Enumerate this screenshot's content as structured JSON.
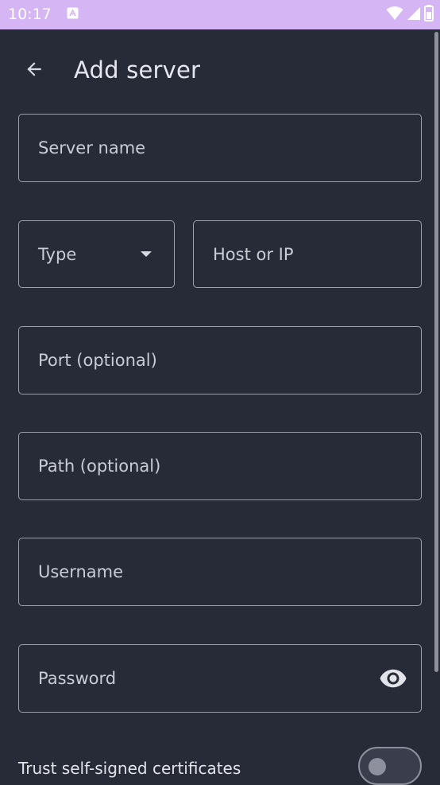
{
  "status_bar": {
    "time": "10:17"
  },
  "header": {
    "title": "Add server"
  },
  "form": {
    "server_name": {
      "placeholder": "Server name"
    },
    "type": {
      "label": "Type"
    },
    "host": {
      "placeholder": "Host or IP"
    },
    "port": {
      "placeholder": "Port (optional)"
    },
    "path": {
      "placeholder": "Path (optional)"
    },
    "username": {
      "placeholder": "Username"
    },
    "password": {
      "placeholder": "Password"
    },
    "trust_certificates": {
      "label": "Trust self-signed certificates",
      "enabled": false
    }
  },
  "icons": {
    "back": "arrow-back-icon",
    "dropdown": "caret-down-icon",
    "visibility": "eye-icon",
    "wifi": "wifi-icon",
    "signal": "signal-icon",
    "battery": "battery-icon",
    "notification": "notification-icon"
  },
  "colors": {
    "background": "#272b38",
    "status_bar": "#d5b5f4",
    "outline": "#9da0ae",
    "text": "#d9dbe3"
  }
}
